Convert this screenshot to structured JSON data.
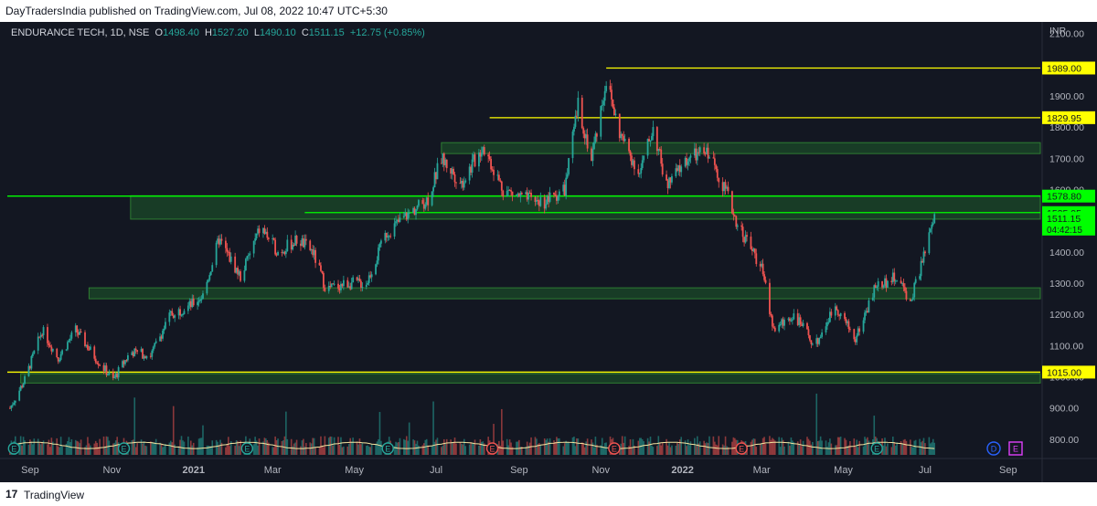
{
  "header": {
    "publish_line": "DayTradersIndia published on TradingView.com, Jul 08, 2022 10:47 UTC+5:30"
  },
  "footer": {
    "logo_glyph": "17",
    "brand": "TradingView"
  },
  "legend": {
    "symbol": "ENDURANCE TECH, 1D, NSE",
    "o_label": "O",
    "o_value": "1498.40",
    "h_label": "H",
    "h_value": "1527.20",
    "l_label": "L",
    "l_value": "1490.10",
    "c_label": "C",
    "c_value": "1511.15",
    "change": "+12.75 (+0.85%)"
  },
  "colors": {
    "background": "#131722",
    "up": "#26a69a",
    "down": "#ef5350",
    "yellow_line": "#ffff00",
    "green_line": "#00ff00",
    "zone_fill": "#1e5b2a",
    "volume_ma": "#f7e7a1"
  },
  "chart_data": {
    "type": "candlestick",
    "currency": "INR",
    "ylim": [
      750,
      2125
    ],
    "y_ticks": [
      800,
      900,
      1000,
      1100,
      1200,
      1300,
      1400,
      1500,
      1600,
      1700,
      1800,
      1900,
      2000,
      2100
    ],
    "y_tick_labels": [
      "800.00",
      "900.00",
      "1000.00",
      "1100.00",
      "1200.00",
      "1300.00",
      "1400.00",
      "1500.00",
      "1600.00",
      "1700.00",
      "1800.00",
      "1900.00",
      "2000.00",
      "2100.00"
    ],
    "x_range": [
      "2020-08-15",
      "2022-09-25"
    ],
    "x_ticks": [
      {
        "date": "2020-09-01",
        "label": "Sep"
      },
      {
        "date": "2020-11-01",
        "label": "Nov"
      },
      {
        "date": "2021-01-01",
        "label": "2021"
      },
      {
        "date": "2021-03-01",
        "label": "Mar"
      },
      {
        "date": "2021-05-01",
        "label": "May"
      },
      {
        "date": "2021-07-01",
        "label": "Jul"
      },
      {
        "date": "2021-09-01",
        "label": "Sep"
      },
      {
        "date": "2021-11-01",
        "label": "Nov"
      },
      {
        "date": "2022-01-01",
        "label": "2022"
      },
      {
        "date": "2022-03-01",
        "label": "Mar"
      },
      {
        "date": "2022-05-01",
        "label": "May"
      },
      {
        "date": "2022-07-01",
        "label": "Jul"
      },
      {
        "date": "2022-09-01",
        "label": "Sep"
      }
    ],
    "price_path": [
      [
        "2020-08-17",
        900
      ],
      [
        "2020-08-28",
        990
      ],
      [
        "2020-09-10",
        1150
      ],
      [
        "2020-09-22",
        1060
      ],
      [
        "2020-10-05",
        1150
      ],
      [
        "2020-10-20",
        1060
      ],
      [
        "2020-11-02",
        990
      ],
      [
        "2020-11-15",
        1080
      ],
      [
        "2020-11-30",
        1070
      ],
      [
        "2020-12-15",
        1200
      ],
      [
        "2020-12-30",
        1230
      ],
      [
        "2021-01-08",
        1260
      ],
      [
        "2021-01-20",
        1440
      ],
      [
        "2021-02-05",
        1320
      ],
      [
        "2021-02-20",
        1480
      ],
      [
        "2021-03-05",
        1400
      ],
      [
        "2021-03-20",
        1440
      ],
      [
        "2021-03-31",
        1400
      ],
      [
        "2021-04-10",
        1280
      ],
      [
        "2021-04-25",
        1300
      ],
      [
        "2021-05-10",
        1300
      ],
      [
        "2021-05-25",
        1460
      ],
      [
        "2021-06-10",
        1520
      ],
      [
        "2021-06-25",
        1570
      ],
      [
        "2021-07-05",
        1700
      ],
      [
        "2021-07-20",
        1620
      ],
      [
        "2021-08-05",
        1740
      ],
      [
        "2021-08-20",
        1600
      ],
      [
        "2021-09-05",
        1570
      ],
      [
        "2021-09-20",
        1560
      ],
      [
        "2021-10-05",
        1600
      ],
      [
        "2021-10-15",
        1870
      ],
      [
        "2021-10-25",
        1700
      ],
      [
        "2021-11-05",
        1950
      ],
      [
        "2021-11-15",
        1780
      ],
      [
        "2021-11-30",
        1650
      ],
      [
        "2021-12-10",
        1800
      ],
      [
        "2021-12-20",
        1610
      ],
      [
        "2022-01-05",
        1700
      ],
      [
        "2022-01-20",
        1720
      ],
      [
        "2022-02-02",
        1600
      ],
      [
        "2022-02-10",
        1500
      ],
      [
        "2022-02-15",
        1460
      ],
      [
        "2022-03-01",
        1350
      ],
      [
        "2022-03-10",
        1150
      ],
      [
        "2022-03-25",
        1200
      ],
      [
        "2022-04-10",
        1100
      ],
      [
        "2022-04-25",
        1230
      ],
      [
        "2022-05-10",
        1120
      ],
      [
        "2022-05-25",
        1290
      ],
      [
        "2022-06-10",
        1320
      ],
      [
        "2022-06-20",
        1240
      ],
      [
        "2022-07-01",
        1400
      ],
      [
        "2022-07-08",
        1511.15
      ]
    ],
    "horizontal_lines": [
      {
        "price": 1989.0,
        "label": "1989.00",
        "color": "yellow",
        "start": "2021-11-05"
      },
      {
        "price": 1829.95,
        "label": "1829.95",
        "color": "yellow",
        "start": "2021-08-10"
      },
      {
        "price": 1578.8,
        "label": "1578.80",
        "color": "green",
        "start": "2020-08-15"
      },
      {
        "price": 1525.95,
        "label": "1525.95",
        "color": "green",
        "start": "2021-03-25"
      },
      {
        "price": 1015.0,
        "label": "1015.00",
        "color": "yellow",
        "start": "2020-08-15"
      }
    ],
    "zones": [
      {
        "start": "2021-07-05",
        "top": 1750,
        "bottom": 1715
      },
      {
        "start": "2020-11-15",
        "top": 1580,
        "bottom": 1505
      },
      {
        "start": "2020-10-15",
        "top": 1285,
        "bottom": 1250
      },
      {
        "start": "2020-08-25",
        "top": 1010,
        "bottom": 980
      }
    ],
    "last_price": {
      "value": "1511.15",
      "countdown": "04:42:15"
    },
    "earnings_markers": [
      {
        "date": "2020-08-20",
        "type": "E",
        "sign": "up"
      },
      {
        "date": "2020-11-10",
        "type": "E",
        "sign": "up"
      },
      {
        "date": "2021-02-10",
        "type": "E",
        "sign": "up"
      },
      {
        "date": "2021-05-26",
        "type": "E",
        "sign": "up"
      },
      {
        "date": "2021-08-12",
        "type": "E",
        "sign": "down"
      },
      {
        "date": "2021-11-11",
        "type": "E",
        "sign": "down"
      },
      {
        "date": "2022-02-14",
        "type": "E",
        "sign": "down"
      },
      {
        "date": "2022-05-26",
        "type": "E",
        "sign": "up"
      }
    ],
    "dividend_marker": {
      "label": "D"
    },
    "future_earnings_marker": {
      "label": "E"
    },
    "grid": false
  }
}
